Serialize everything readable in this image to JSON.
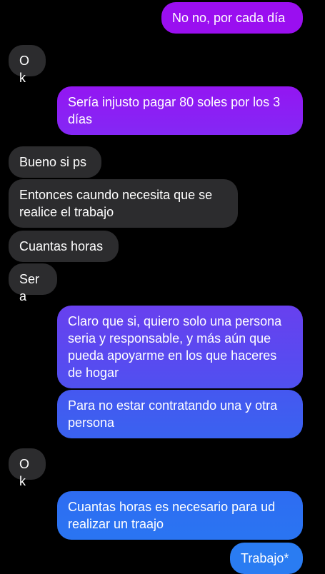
{
  "conversation": {
    "messages": [
      {
        "direction": "outgoing",
        "text": "No no, por cada día",
        "color": "#9a0ff0"
      },
      {
        "direction": "incoming",
        "text": "Ok",
        "color": "#2c2c2e"
      },
      {
        "direction": "outgoing",
        "text": "Sería injusto pagar 80 soles por los 3 días",
        "color": "#8a22f5"
      },
      {
        "direction": "incoming",
        "text": "Bueno si ps",
        "color": "#2c2c2e"
      },
      {
        "direction": "incoming",
        "text": "Entonces caundo necesita que se realice el trabajo",
        "color": "#2c2c2e"
      },
      {
        "direction": "incoming",
        "text": "Cuantas horas",
        "color": "#2c2c2e"
      },
      {
        "direction": "incoming",
        "text": "Sera",
        "color": "#2c2c2e"
      },
      {
        "direction": "outgoing",
        "text": "Claro que si, quiero solo una persona seria y responsable, y más aún que pueda apoyarme en los que haceres de hogar",
        "color": "#5a48f0"
      },
      {
        "direction": "outgoing",
        "text": "Para no estar contratando una y otra persona",
        "color": "#3a5ef0"
      },
      {
        "direction": "incoming",
        "text": "Ok",
        "color": "#2c2c2e"
      },
      {
        "direction": "outgoing",
        "text": "Cuantas horas es necesario para ud realizar un traajo",
        "color": "#2a6ff2"
      },
      {
        "direction": "outgoing",
        "text": "Trabajo*",
        "color": "#2a7af2"
      }
    ]
  }
}
